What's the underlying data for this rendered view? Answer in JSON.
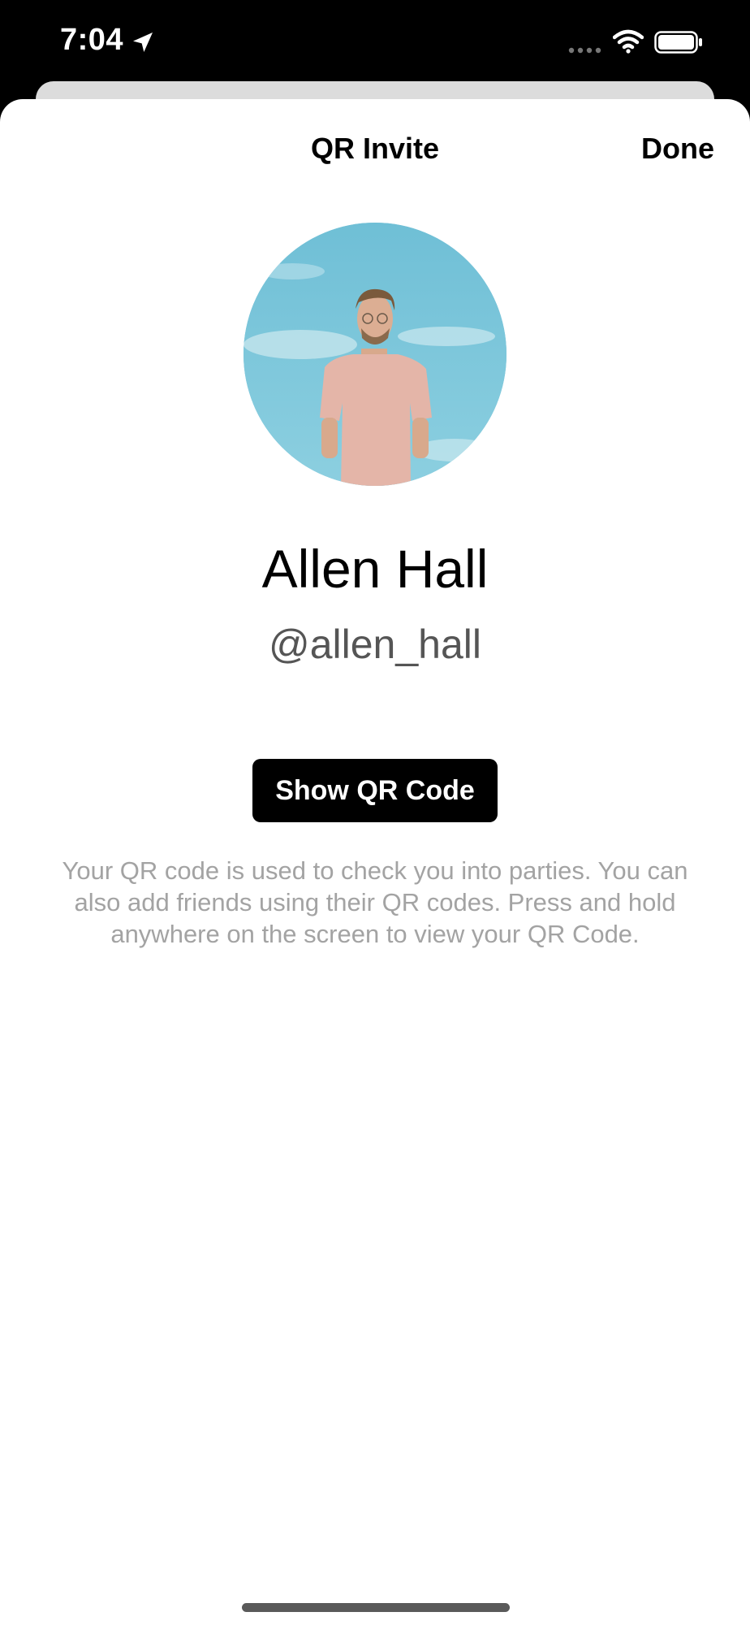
{
  "status_bar": {
    "time": "7:04",
    "icons": [
      "location-arrow-icon",
      "signal-icon",
      "wifi-icon",
      "battery-icon"
    ]
  },
  "sheet": {
    "title": "QR Invite",
    "done_label": "Done"
  },
  "profile": {
    "name": "Allen Hall",
    "handle": "@allen_hall",
    "avatar_icon": "profile-photo"
  },
  "qr": {
    "button_label": "Show QR Code",
    "description": "Your QR code is used to check you into parties. You can also add friends using their QR codes. Press and hold anywhere on the screen to view your QR Code."
  },
  "colors": {
    "accent": "#000000",
    "secondary_text": "#555555",
    "muted_text": "#a3a3a3",
    "avatar_sky": "#79c3d7"
  }
}
